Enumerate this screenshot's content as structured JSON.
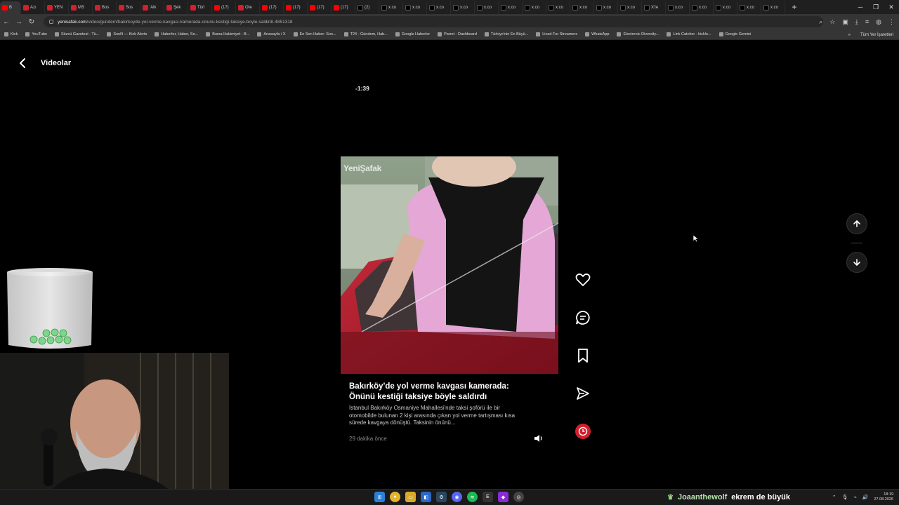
{
  "browser": {
    "tabs": [
      {
        "label": "B",
        "fav": "yt"
      },
      {
        "label": "Azı",
        "fav": "red"
      },
      {
        "label": "YEN",
        "fav": "red"
      },
      {
        "label": "MS",
        "fav": "red"
      },
      {
        "label": "Bos",
        "fav": "red"
      },
      {
        "label": "Sos",
        "fav": "red"
      },
      {
        "label": "'Alk",
        "fav": "red"
      },
      {
        "label": "Şek",
        "fav": "red"
      },
      {
        "label": "Türl",
        "fav": "red"
      },
      {
        "label": "(17)",
        "fav": "yt"
      },
      {
        "label": "Ote",
        "fav": "red"
      },
      {
        "label": "(17)",
        "fav": "yt"
      },
      {
        "label": "(17)",
        "fav": "yt"
      },
      {
        "label": "(17)",
        "fav": "yt"
      },
      {
        "label": "(17)",
        "fav": "yt"
      },
      {
        "label": "(2)",
        "fav": "x"
      },
      {
        "label": "x.co",
        "fav": "x"
      },
      {
        "label": "x.co",
        "fav": "x"
      },
      {
        "label": "x.co",
        "fav": "x"
      },
      {
        "label": "x.co",
        "fav": "x"
      },
      {
        "label": "x.co",
        "fav": "x"
      },
      {
        "label": "x.co",
        "fav": "x"
      },
      {
        "label": "x.co",
        "fav": "x"
      },
      {
        "label": "x.co",
        "fav": "x"
      },
      {
        "label": "x.co",
        "fav": "x"
      },
      {
        "label": "x.co",
        "fav": "x"
      },
      {
        "label": "x.co",
        "fav": "x"
      },
      {
        "label": "X'te",
        "fav": "x"
      },
      {
        "label": "x.co",
        "fav": "x"
      },
      {
        "label": "x.co",
        "fav": "x"
      },
      {
        "label": "x.co",
        "fav": "x"
      },
      {
        "label": "x.co",
        "fav": "x"
      },
      {
        "label": "x.co",
        "fav": "x"
      }
    ],
    "url_host": "yenisafak.com",
    "url_path": "/video/gundem/bakirkoyde-yol-verme-kavgasi-kamerada-onunu-kestigi-taksiye-boyle-saldirdi-4851318",
    "bookmarks": [
      "Kick",
      "YouTube",
      "Sözcü Gazetesi - Tü...",
      "SooN — Kick Alerts",
      "Haberler, Haber, So...",
      "Bursa Hakimiyet - B...",
      "Anasayfa / X",
      "En Son Haber: Son...",
      "T24 - Gündem, Hab...",
      "Google Haberler",
      "Parrot - Dashboard",
      "Türkiye'nin En Büyü...",
      "Livad For Streamers",
      "WhatsApp",
      "Electronic Diversity...",
      "Link Catcher - kicklo...",
      "Google Gemini"
    ],
    "all_bookmarks": "Tüm Yer İşaretleri"
  },
  "page": {
    "title": "Videolar",
    "timer": "-1:39",
    "watermark": "YeniŞafak",
    "headline": "Bakırköy'de yol verme kavgası kamerada: Önünü kestiği taksiye böyle saldırdı",
    "description": "İstanbul Bakırköy Osmaniye Mahallesi'nde taksi şoförü ile bir otomobilde bulunan 2 kişi arasında çıkan yol verme tartışması kısa sürede kavgaya dönüştü. Taksinin önünü...",
    "time_ago": "29 dakika önce"
  },
  "taskbar": {
    "chat_user": "Joaanthewolf",
    "chat_message": "ekrem de büyük",
    "time": "18:19",
    "date": "27.08.2026"
  }
}
